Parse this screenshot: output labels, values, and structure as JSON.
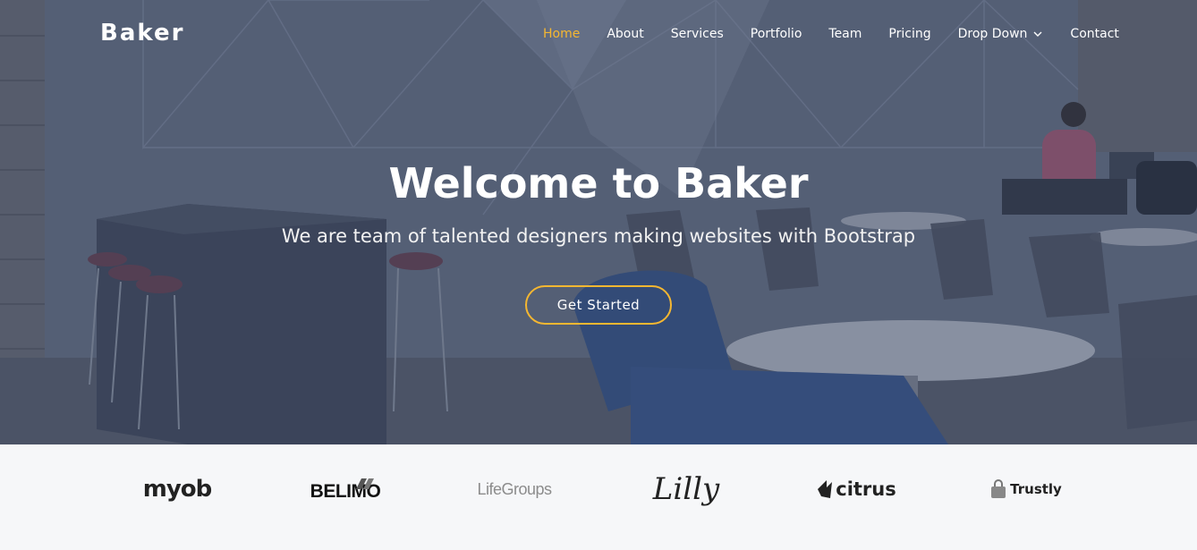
{
  "brand": {
    "logo": "Baker"
  },
  "nav": {
    "items": [
      {
        "label": "Home",
        "active": true
      },
      {
        "label": "About"
      },
      {
        "label": "Services"
      },
      {
        "label": "Portfolio"
      },
      {
        "label": "Team"
      },
      {
        "label": "Pricing"
      },
      {
        "label": "Drop Down",
        "has_dropdown": true
      },
      {
        "label": "Contact"
      }
    ]
  },
  "hero": {
    "title": "Welcome to Baker",
    "subtitle": "We are team of talented designers making websites with Bootstrap",
    "cta_label": "Get Started"
  },
  "clients": {
    "logos": [
      {
        "name": "myob",
        "text": "myob"
      },
      {
        "name": "belimo",
        "text": "BELIMO"
      },
      {
        "name": "lifegroups",
        "text": "LifeGroups"
      },
      {
        "name": "lilly",
        "text": "Lilly"
      },
      {
        "name": "citrus",
        "text": "citrus"
      },
      {
        "name": "trustly",
        "text": "Trustly"
      }
    ]
  },
  "colors": {
    "accent": "#f5b731",
    "overlay": "#3a4866",
    "clients_bg": "#f6f7f9"
  }
}
